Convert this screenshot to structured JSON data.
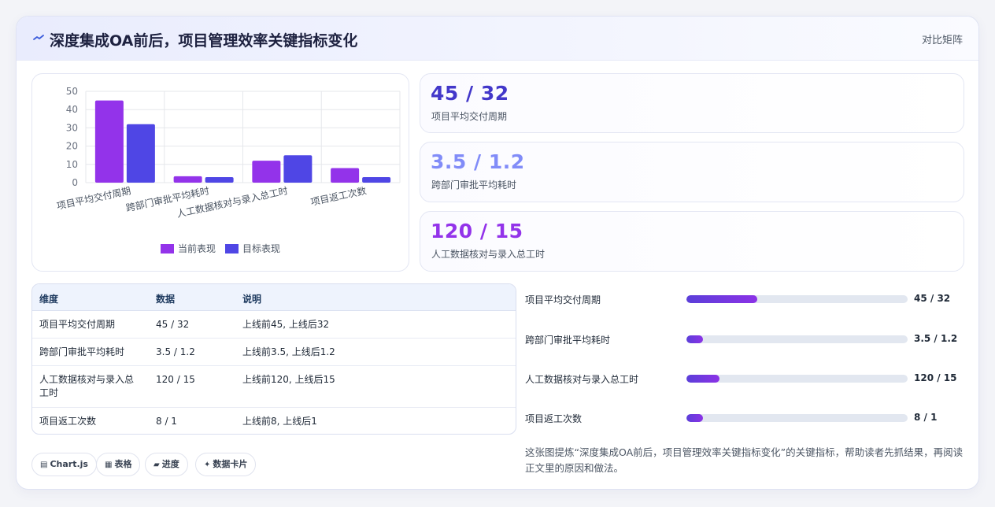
{
  "header": {
    "title": "深度集成OA前后，项目管理效率关键指标变化",
    "right_label": "对比矩阵",
    "icon": "trend-icon"
  },
  "chart_data": {
    "type": "bar",
    "categories": [
      "项目平均交付周期",
      "跨部门审批平均耗时",
      "人工数据核对与录入总工时",
      "项目返工次数"
    ],
    "series": [
      {
        "name": "当前表现",
        "values": [
          45,
          3.5,
          12,
          8
        ],
        "color": "#9333ea"
      },
      {
        "name": "目标表现",
        "values": [
          32,
          3,
          15,
          3
        ],
        "color": "#4f46e5"
      }
    ],
    "yticks": [
      0,
      10,
      20,
      30,
      40,
      50
    ],
    "ylim": [
      0,
      50
    ],
    "legend_position": "bottom",
    "grid": true
  },
  "kpis": [
    {
      "value": "45 / 32",
      "label": "项目平均交付周期",
      "color": "#4338ca"
    },
    {
      "value": "3.5 / 1.2",
      "label": "跨部门审批平均耗时",
      "color": "#818cf8"
    },
    {
      "value": "120 / 15",
      "label": "人工数据核对与录入总工时",
      "color": "#9333ea"
    }
  ],
  "table": {
    "headers": [
      "维度",
      "数据",
      "说明"
    ],
    "rows": [
      [
        "项目平均交付周期",
        "45 / 32",
        "上线前45, 上线后32"
      ],
      [
        "跨部门审批平均耗时",
        "3.5 / 1.2",
        "上线前3.5, 上线后1.2"
      ],
      [
        "人工数据核对与录入总工时",
        "120 / 15",
        "上线前120, 上线后15"
      ],
      [
        "项目返工次数",
        "8 / 1",
        "上线前8, 上线后1"
      ]
    ]
  },
  "progress": [
    {
      "label": "项目平均交付周期",
      "value": "45 / 32",
      "fraction": 0.32
    },
    {
      "label": "跨部门审批平均耗时",
      "value": "3.5 / 1.2",
      "fraction": 0.075
    },
    {
      "label": "人工数据核对与录入总工时",
      "value": "120 / 15",
      "fraction": 0.15
    },
    {
      "label": "项目返工次数",
      "value": "8 / 1",
      "fraction": 0.075
    }
  ],
  "chips": [
    {
      "icon": "▤",
      "label": "Chart.js"
    },
    {
      "icon": "▦",
      "label": "表格"
    },
    {
      "icon": "▰",
      "label": "进度"
    },
    {
      "icon": "✦",
      "label": "数据卡片"
    }
  ],
  "note": "这张图提炼“深度集成OA前后，项目管理效率关键指标变化”的关键指标，帮助读者先抓结果，再阅读正文里的原因和做法。"
}
